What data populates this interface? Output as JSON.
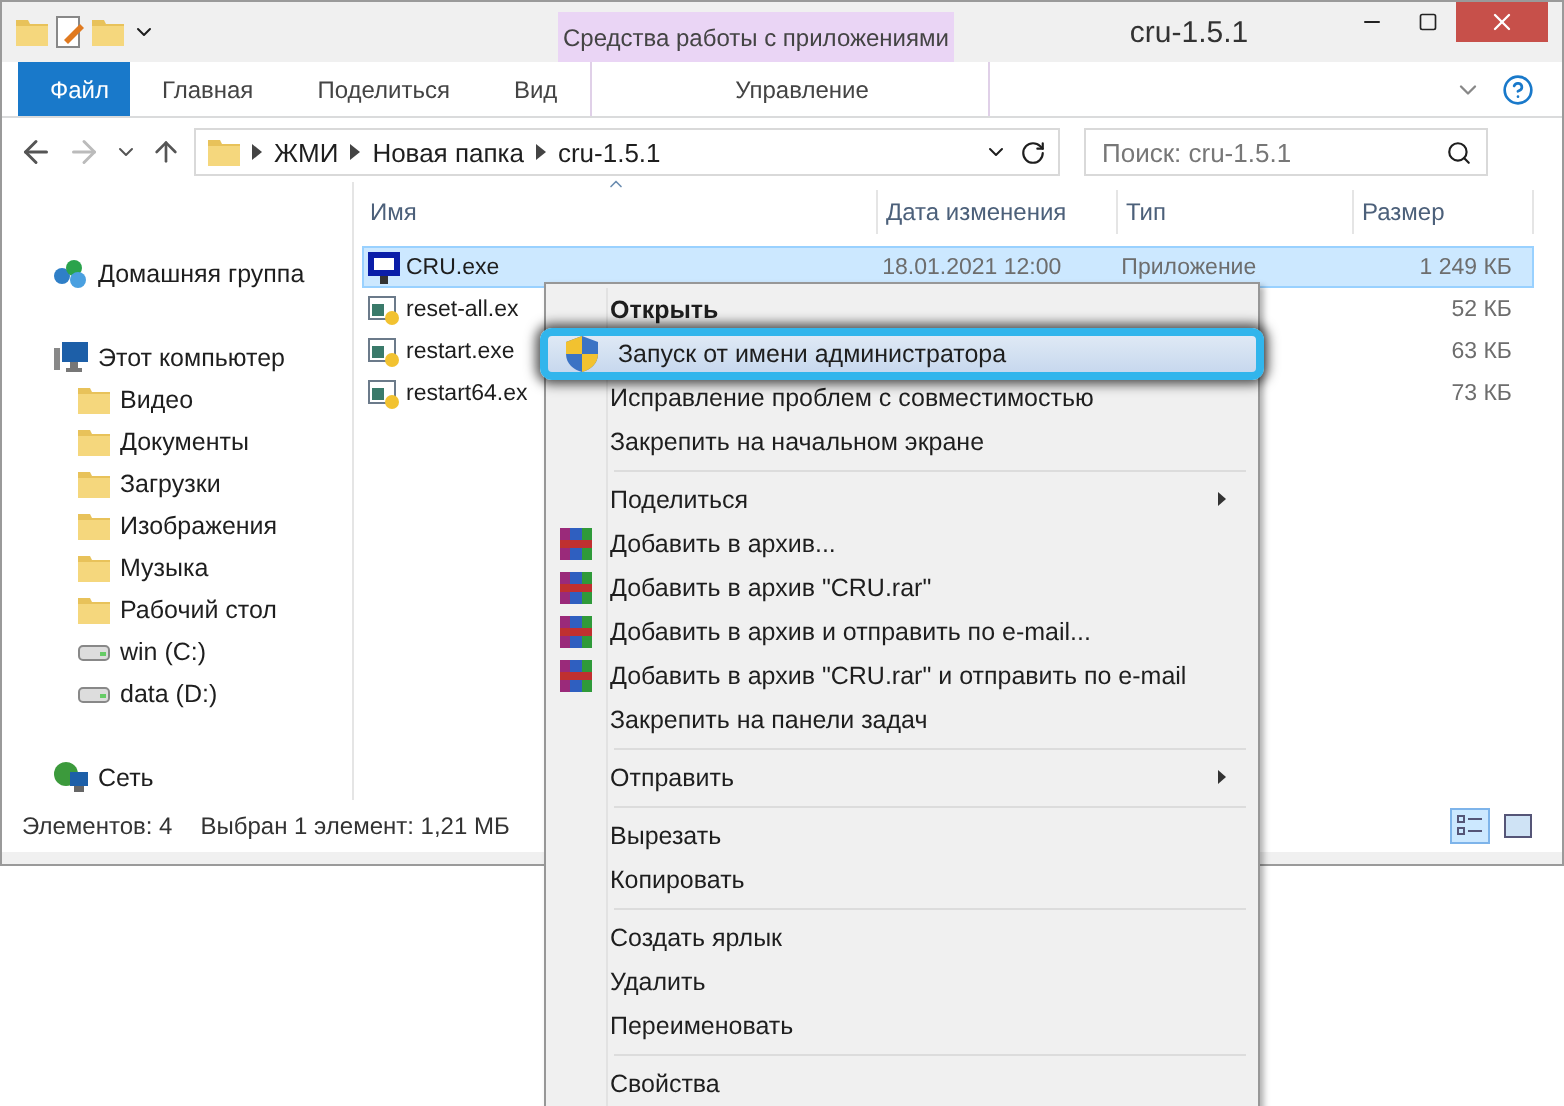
{
  "window": {
    "title": "cru-1.5.1",
    "tool_group": "Средства работы с приложениями"
  },
  "ribbon_tabs": [
    {
      "label": "Файл",
      "kind": "file"
    },
    {
      "label": "Главная",
      "kind": "tab"
    },
    {
      "label": "Поделиться",
      "kind": "tab"
    },
    {
      "label": "Вид",
      "kind": "tab"
    },
    {
      "label": "Управление",
      "kind": "tool"
    }
  ],
  "address": {
    "path": [
      "ЖМИ",
      "Новая папка",
      "cru-1.5.1"
    ]
  },
  "search": {
    "placeholder": "Поиск: cru-1.5.1"
  },
  "columns": [
    "Имя",
    "Дата изменения",
    "Тип",
    "Размер"
  ],
  "files": [
    {
      "name": "CRU.exe",
      "modified": "18.01.2021 12:00",
      "type": "Приложение",
      "size": "1 249 КБ",
      "selected": true,
      "kind": "app"
    },
    {
      "name": "reset-all.ex",
      "size": "52 КБ",
      "selected": false,
      "kind": "exe"
    },
    {
      "name": "restart.exe",
      "size": "63 КБ",
      "selected": false,
      "kind": "exe"
    },
    {
      "name": "restart64.ex",
      "size": "73 КБ",
      "selected": false,
      "kind": "exe"
    }
  ],
  "sidebar": {
    "items": [
      {
        "label": "Домашняя группа",
        "kind": "homegroup"
      },
      {
        "label": "Этот компьютер",
        "kind": "computer",
        "children": [
          {
            "label": "Видео",
            "kind": "folder"
          },
          {
            "label": "Документы",
            "kind": "folder"
          },
          {
            "label": "Загрузки",
            "kind": "folder"
          },
          {
            "label": "Изображения",
            "kind": "folder"
          },
          {
            "label": "Музыка",
            "kind": "folder"
          },
          {
            "label": "Рабочий стол",
            "kind": "folder"
          },
          {
            "label": "win (C:)",
            "kind": "drive"
          },
          {
            "label": "data (D:)",
            "kind": "drive"
          }
        ]
      },
      {
        "label": "Сеть",
        "kind": "network"
      }
    ]
  },
  "status_bar": {
    "count": "Элементов: 4",
    "selection": "Выбран 1 элемент: 1,21 МБ"
  },
  "view_buttons": [
    {
      "kind": "details",
      "selected": true
    },
    {
      "kind": "tiles",
      "selected": false
    }
  ],
  "context_menu": {
    "groups": [
      [
        {
          "label": "Открыть",
          "kind": "default",
          "selected": false
        },
        {
          "label": "Запуск от имени администратора",
          "kind": "elevated",
          "selected": true
        },
        {
          "label": "Исправление проблем с совместимостью",
          "kind": "command",
          "selected": false
        },
        {
          "label": "Закрепить на начальном экране",
          "kind": "command",
          "selected": false
        }
      ],
      [
        {
          "label": "Поделиться",
          "kind": "submenu",
          "selected": false
        },
        {
          "label": "Добавить в архив...",
          "kind": "archive",
          "selected": false
        },
        {
          "label": "Добавить в архив \"CRU.rar\"",
          "kind": "archive",
          "selected": false
        },
        {
          "label": "Добавить в архив и отправить по e-mail...",
          "kind": "archive",
          "selected": false
        },
        {
          "label": "Добавить в архив \"CRU.rar\" и отправить по e-mail",
          "kind": "archive",
          "selected": false
        },
        {
          "label": "Закрепить на панели задач",
          "kind": "command",
          "selected": false
        }
      ],
      [
        {
          "label": "Отправить",
          "kind": "submenu",
          "selected": false
        }
      ],
      [
        {
          "label": "Вырезать",
          "kind": "command",
          "selected": false
        },
        {
          "label": "Копировать",
          "kind": "command",
          "selected": false
        }
      ],
      [
        {
          "label": "Создать ярлык",
          "kind": "command",
          "selected": false
        },
        {
          "label": "Удалить",
          "kind": "command",
          "selected": false
        },
        {
          "label": "Переименовать",
          "kind": "command",
          "selected": false
        }
      ],
      [
        {
          "label": "Свойства",
          "kind": "command",
          "selected": false
        }
      ]
    ]
  }
}
